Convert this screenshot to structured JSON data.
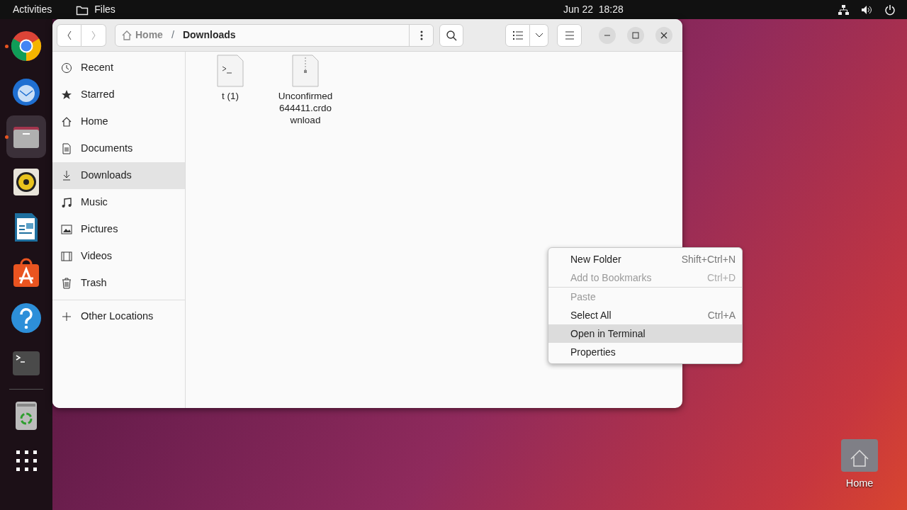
{
  "top_bar": {
    "activities": "Activities",
    "app_menu": "Files",
    "clock": "Jun 22  18:28"
  },
  "dock": {
    "apps": [
      {
        "kind": "browser",
        "running": true,
        "selected": false
      },
      {
        "kind": "mail",
        "running": false,
        "selected": false
      },
      {
        "kind": "files",
        "running": true,
        "selected": true
      },
      {
        "kind": "music",
        "running": false,
        "selected": false
      },
      {
        "kind": "writer",
        "running": false,
        "selected": false
      },
      {
        "kind": "store",
        "running": false,
        "selected": false
      },
      {
        "kind": "help",
        "running": false,
        "selected": false
      },
      {
        "kind": "terminal",
        "running": false,
        "selected": false
      },
      {
        "kind": "trash",
        "running": false,
        "selected": false
      },
      {
        "kind": "grid",
        "running": false,
        "selected": false
      }
    ]
  },
  "window": {
    "path_separator": "/",
    "path": [
      {
        "label": "Home",
        "kind": "home"
      },
      {
        "label": "Downloads",
        "kind": "current"
      }
    ],
    "sidebar": {
      "items": [
        {
          "label": "Recent",
          "kind": "clock",
          "selected": false
        },
        {
          "label": "Starred",
          "kind": "star",
          "selected": false
        },
        {
          "label": "Home",
          "kind": "home",
          "selected": false
        },
        {
          "label": "Documents",
          "kind": "document",
          "selected": false
        },
        {
          "label": "Downloads",
          "kind": "download",
          "selected": true
        },
        {
          "label": "Music",
          "kind": "music",
          "selected": false
        },
        {
          "label": "Pictures",
          "kind": "picture",
          "selected": false
        },
        {
          "label": "Videos",
          "kind": "film",
          "selected": false
        },
        {
          "label": "Trash",
          "kind": "trash",
          "selected": false
        }
      ],
      "other": {
        "label": "Other Locations"
      }
    },
    "files": [
      {
        "name": "t (1)",
        "kind": "script"
      },
      {
        "name": "Unconfirmed 644411.crdownload",
        "kind": "archive"
      }
    ]
  },
  "context_menu": {
    "groups": [
      [
        {
          "label": "New Folder",
          "shortcut": "Shift+Ctrl+N",
          "disabled": false,
          "selected": false
        },
        {
          "label": "Add to Bookmarks",
          "shortcut": "Ctrl+D",
          "disabled": true,
          "selected": false
        }
      ],
      [
        {
          "label": "Paste",
          "disabled": true,
          "selected": false
        },
        {
          "label": "Select All",
          "shortcut": "Ctrl+A",
          "disabled": false,
          "selected": false
        },
        {
          "label": "Open in Terminal",
          "disabled": false,
          "selected": true
        },
        {
          "label": "Properties",
          "disabled": false,
          "selected": false
        }
      ]
    ]
  },
  "desktop": {
    "icons": [
      {
        "label": "Home"
      }
    ]
  }
}
